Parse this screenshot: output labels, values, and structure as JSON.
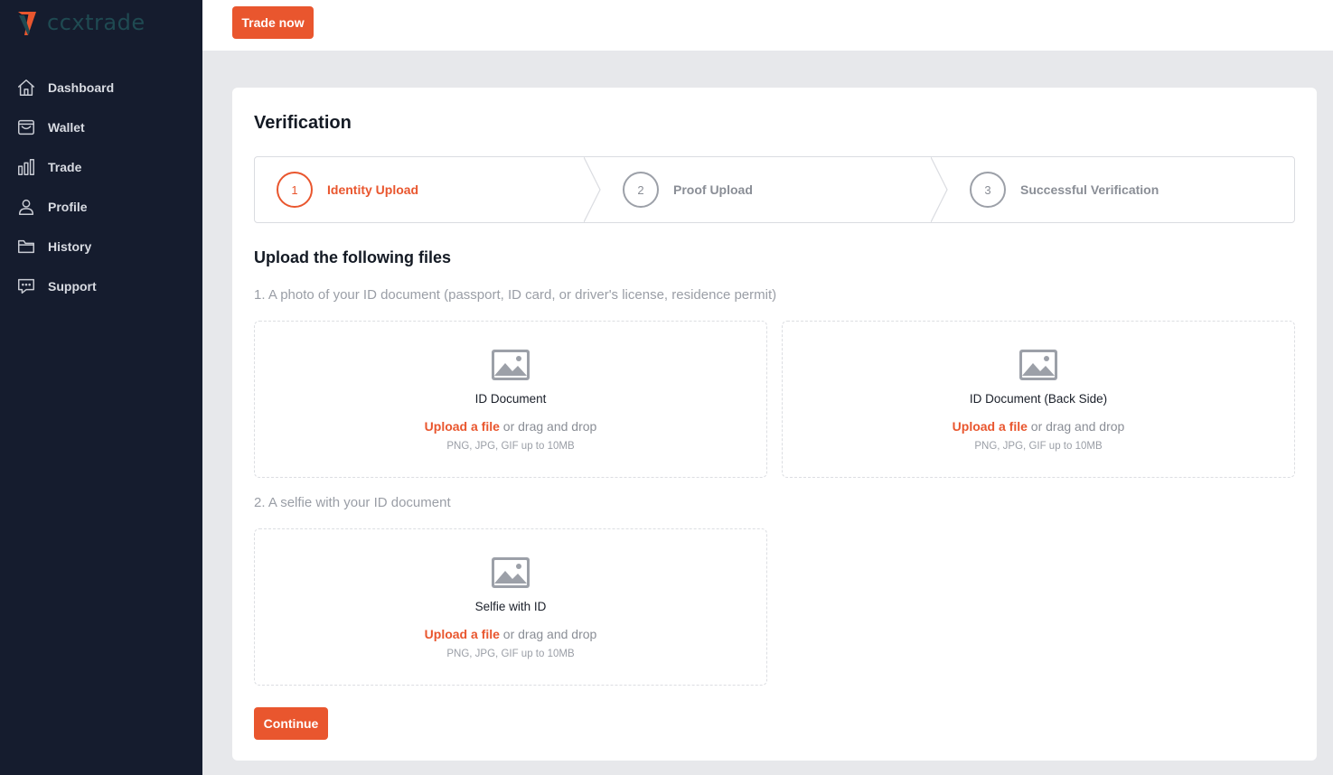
{
  "logo": {
    "text": "ccxtrade"
  },
  "sidebar": {
    "items": [
      {
        "label": "Dashboard",
        "icon": "home-icon"
      },
      {
        "label": "Wallet",
        "icon": "wallet-icon"
      },
      {
        "label": "Trade",
        "icon": "bar-chart-icon"
      },
      {
        "label": "Profile",
        "icon": "user-icon"
      },
      {
        "label": "History",
        "icon": "folder-icon"
      },
      {
        "label": "Support",
        "icon": "chat-icon"
      }
    ]
  },
  "topbar": {
    "trade_now_label": "Trade now"
  },
  "verification": {
    "title": "Verification",
    "steps": [
      {
        "number": "1",
        "label": "Identity Upload",
        "state": "active"
      },
      {
        "number": "2",
        "label": "Proof Upload",
        "state": "inactive"
      },
      {
        "number": "3",
        "label": "Successful Verification",
        "state": "inactive"
      }
    ],
    "section_title": "Upload the following files",
    "instruction_1": "1. A photo of your ID document (passport, ID card, or driver's license, residence permit)",
    "instruction_2": "2. A selfie with your ID document",
    "uploads": [
      {
        "name": "ID Document",
        "link": "Upload a file",
        "rest": " or drag and drop",
        "hint": "PNG, JPG, GIF up to 10MB"
      },
      {
        "name": "ID Document (Back Side)",
        "link": "Upload a file",
        "rest": " or drag and drop",
        "hint": "PNG, JPG, GIF up to 10MB"
      },
      {
        "name": "Selfie with ID",
        "link": "Upload a file",
        "rest": " or drag and drop",
        "hint": "PNG, JPG, GIF up to 10MB"
      }
    ],
    "continue_label": "Continue"
  },
  "colors": {
    "accent": "#e9562e",
    "sidebar_bg": "#151c2e",
    "page_bg": "#e7e8eb"
  }
}
